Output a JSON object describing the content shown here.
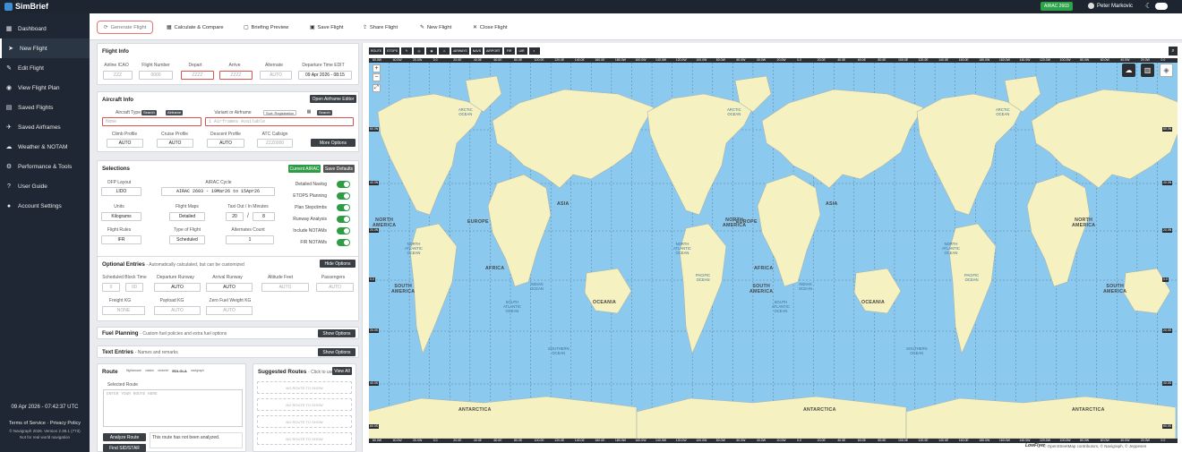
{
  "topbar": {
    "brand": "SimBrief",
    "airac_badge": "AIRAC 2603",
    "user_name": "Peter Markovic"
  },
  "sidebar": {
    "items": [
      {
        "label": "Dashboard",
        "icon": "dashboard-icon",
        "glyph": "▦"
      },
      {
        "label": "New Flight",
        "icon": "paper-plane-icon",
        "glyph": "➤"
      },
      {
        "label": "Edit Flight",
        "icon": "edit-icon",
        "glyph": "✎"
      },
      {
        "label": "View Flight Plan",
        "icon": "eye-icon",
        "glyph": "◉"
      },
      {
        "label": "Saved Flights",
        "icon": "folder-icon",
        "glyph": "▤"
      },
      {
        "label": "Saved Airframes",
        "icon": "plane-icon",
        "glyph": "✈"
      },
      {
        "label": "Weather & NOTAM",
        "icon": "cloud-icon",
        "glyph": "☁"
      },
      {
        "label": "Performance & Tools",
        "icon": "tools-icon",
        "glyph": "⚙"
      },
      {
        "label": "User Guide",
        "icon": "question-icon",
        "glyph": "?"
      },
      {
        "label": "Account Settings",
        "icon": "user-icon",
        "glyph": "●"
      }
    ],
    "datetime": "09 Apr 2026 - 07:42:37 UTC",
    "terms": "Terms of Service",
    "privacy": "Privacy Policy",
    "version": "© Navigraph 2026. Version 2.38.1 (773)",
    "disclaimer": "Not for real world navigation"
  },
  "actions": {
    "generate": "Generate Flight",
    "calculate": "Calculate & Compare",
    "briefing": "Briefing Preview",
    "save": "Save Flight",
    "share": "Share Flight",
    "new": "New Flight",
    "close": "Close Flight"
  },
  "flight_info": {
    "title": "Flight Info",
    "airline_label": "Airline",
    "airline_tag": "ICAO",
    "airline_placeholder": "ZZZ",
    "flightno_label": "Flight Number",
    "flightno_placeholder": "0000",
    "depart_label": "Depart",
    "depart_placeholder": "ZZZZ",
    "arrive_label": "Arrive",
    "arrive_placeholder": "ZZZZ",
    "alternate_label": "Alternate",
    "alternate_value": "AUTO",
    "deptime_label": "Departure Time",
    "deptime_tag": "EDIT",
    "deptime_value": "09 Apr 2026 - 08:15"
  },
  "aircraft_info": {
    "title": "Aircraft Info",
    "open_button": "Open Airframe Editor",
    "type_label": "Aircraft Type",
    "search_tag": "Search",
    "airframe_tag": "Airframe",
    "type_value": "None",
    "variant_label": "Variant or Airframe",
    "sort_label": "Sort: Registration",
    "variant_value": "1 Airframes Available",
    "climb_label": "Climb Profile",
    "climb_value": "AUTO",
    "cruise_label": "Cruise Profile",
    "cruise_value": "AUTO",
    "descent_label": "Descent Profile",
    "descent_value": "AUTO",
    "callsign_label": "ATC Callsign",
    "callsign_placeholder": "ZZZ0000",
    "more_button": "More Options"
  },
  "selections": {
    "title": "Selections",
    "current_airac": "Current AIRAC",
    "save_defaults": "Save Defaults",
    "ofp_label": "OFP Layout",
    "ofp_value": "LIDO",
    "cycle_label": "AIRAC Cycle",
    "cycle_value": "AIRAC 2603 - 19Mar26 to 15Apr26",
    "units_label": "Units",
    "units_value": "Kilograms",
    "maps_label": "Flight Maps",
    "maps_value": "Detailed",
    "taxi_label": "Taxi Out / In",
    "taxi_tag": "Minutes",
    "taxi_out": "20",
    "taxi_sep": "/",
    "taxi_in": "8",
    "rules_label": "Flight Rules",
    "rules_value": "IFR",
    "type_label": "Type of Flight",
    "type_value": "Scheduled",
    "alt_count_label": "Alternates Count",
    "alt_count_value": "1",
    "toggles": [
      "Detailed Navlog",
      "ETOPS Planning",
      "Plan Stepclimbs",
      "Runway Analysis",
      "Include NOTAMs",
      "FIR NOTAMs"
    ]
  },
  "optional": {
    "title": "Optional Entries",
    "subtitle": "- Automatically calculated, but can be customized",
    "hide_button": "Hide Options",
    "block_label": "Scheduled Block Time",
    "block_h": "0",
    "block_m": "00",
    "dep_rwy_label": "Departure Runway",
    "dep_rwy_value": "AUTO",
    "arr_rwy_label": "Arrival Runway",
    "arr_rwy_value": "AUTO",
    "altitude_label": "Altitude",
    "altitude_tag": "Feet",
    "altitude_value": "AUTO",
    "pax_label": "Passengers",
    "pax_value": "AUTO",
    "freight_label": "Freight",
    "freight_tag": "KG",
    "freight_value": "NONE",
    "payload_label": "Payload",
    "payload_tag": "KG",
    "payload_value": "AUTO",
    "zfw_label": "Zero Fuel Weight",
    "zfw_tag": "KG",
    "zfw_value": "AUTO"
  },
  "fuel": {
    "title": "Fuel Planning",
    "subtitle": "- Custom fuel policies and extra fuel options",
    "button": "Show Options"
  },
  "text_entries": {
    "title": "Text Entries",
    "subtitle": "- Names and remarks",
    "button": "Show Options"
  },
  "route": {
    "title": "Route",
    "providers": [
      "flightaware",
      "vatsim",
      "simbrief",
      "EDI-GLA",
      "navigraph"
    ],
    "selected_label": "Selected Route",
    "placeholder": "ENTER YOUR ROUTE HERE",
    "analyze_button": "Analyze Route",
    "find_button": "Find SID/STAR",
    "status": "This route has not been analyzed."
  },
  "suggested": {
    "title": "Suggested Routes",
    "subtitle": "- Click to use",
    "view_all": "View All",
    "rows": [
      "NO ROUTE TO SHOW",
      "NO ROUTE TO SHOW",
      "NO ROUTE TO SHOW",
      "NO ROUTE TO SHOW",
      "NO ROUTE TO SHOW"
    ]
  },
  "map": {
    "tools": [
      "ROUTE",
      "ETOPS",
      "✎",
      "◎",
      "◉",
      "⚠",
      "AIRWAYS",
      "NAVS",
      "AIRPORT",
      "FIR",
      "UIR",
      "◐"
    ],
    "lon_labels": [
      "60.0W",
      "40.0W",
      "20.0W",
      "0.0",
      "20.0E",
      "40.0E",
      "60.0E",
      "80.0E",
      "100.0E",
      "120.0E",
      "140.0E",
      "160.0E",
      "180.0W",
      "160.0W",
      "140.0W",
      "120.0W",
      "100.0W",
      "80.0W",
      "60.0W",
      "40.0W",
      "20.0W",
      "0.0",
      "20.0E",
      "40.0E",
      "60.0E",
      "80.0E",
      "100.0E",
      "120.0E",
      "140.0E",
      "160.0E",
      "180.0W",
      "160.0W",
      "140.0W",
      "120.0W",
      "100.0W",
      "80.0W",
      "60.0W",
      "40.0W",
      "20.0W",
      "0.0"
    ],
    "lat_labels": [
      "60.0N",
      "40.0N",
      "20.0N",
      "0.0",
      "20.0S",
      "40.0S",
      "60.0S"
    ],
    "regions": [
      {
        "name": "NORTH\nAMERICA"
      },
      {
        "name": "EUROPE"
      },
      {
        "name": "ASIA"
      },
      {
        "name": "AFRICA"
      },
      {
        "name": "SOUTH\nAMERICA"
      },
      {
        "name": "OCEANIA"
      },
      {
        "name": "NORTH\nAMERICA"
      },
      {
        "name": "EUROPE"
      },
      {
        "name": "ASIA"
      },
      {
        "name": "AFRICA"
      },
      {
        "name": "SOUTH\nAMERICA"
      },
      {
        "name": "OCEANIA"
      },
      {
        "name": "NORTH\nAMERICA"
      },
      {
        "name": "SOUTH\nAMERICA"
      },
      {
        "name": "ANTARCTICA"
      },
      {
        "name": "ANTARCTICA"
      },
      {
        "name": "ANTARCTICA"
      }
    ],
    "oceans": [
      "ARCTIC\nOCEAN",
      "ARCTIC\nOCEAN",
      "ARCTIC\nOCEAN",
      "NORTH\nATLANTIC\nOCEAN",
      "NORTH\nATLANTIC\nOCEAN",
      "NORTH\nATLANTIC\nOCEAN",
      "PACIFIC\nOCEAN",
      "PACIFIC\nOCEAN",
      "INDIAN\nOCEAN",
      "INDIAN\nOCEAN",
      "SOUTHERN\nOCEAN",
      "SOUTHERN\nOCEAN",
      "SOUTH\nATLANTIC\nOCEAN",
      "SOUTH\nATLANTIC\nOCEAN"
    ],
    "logo": "LowFlyer",
    "attribution": "© OpenStreetMap contributors, © Navigraph, © Jeppesen"
  },
  "colors": {
    "accent": "#2e9c45",
    "sidebar": "#1e2733",
    "land": "#f6f1c1",
    "water": "#8cc9ef"
  }
}
